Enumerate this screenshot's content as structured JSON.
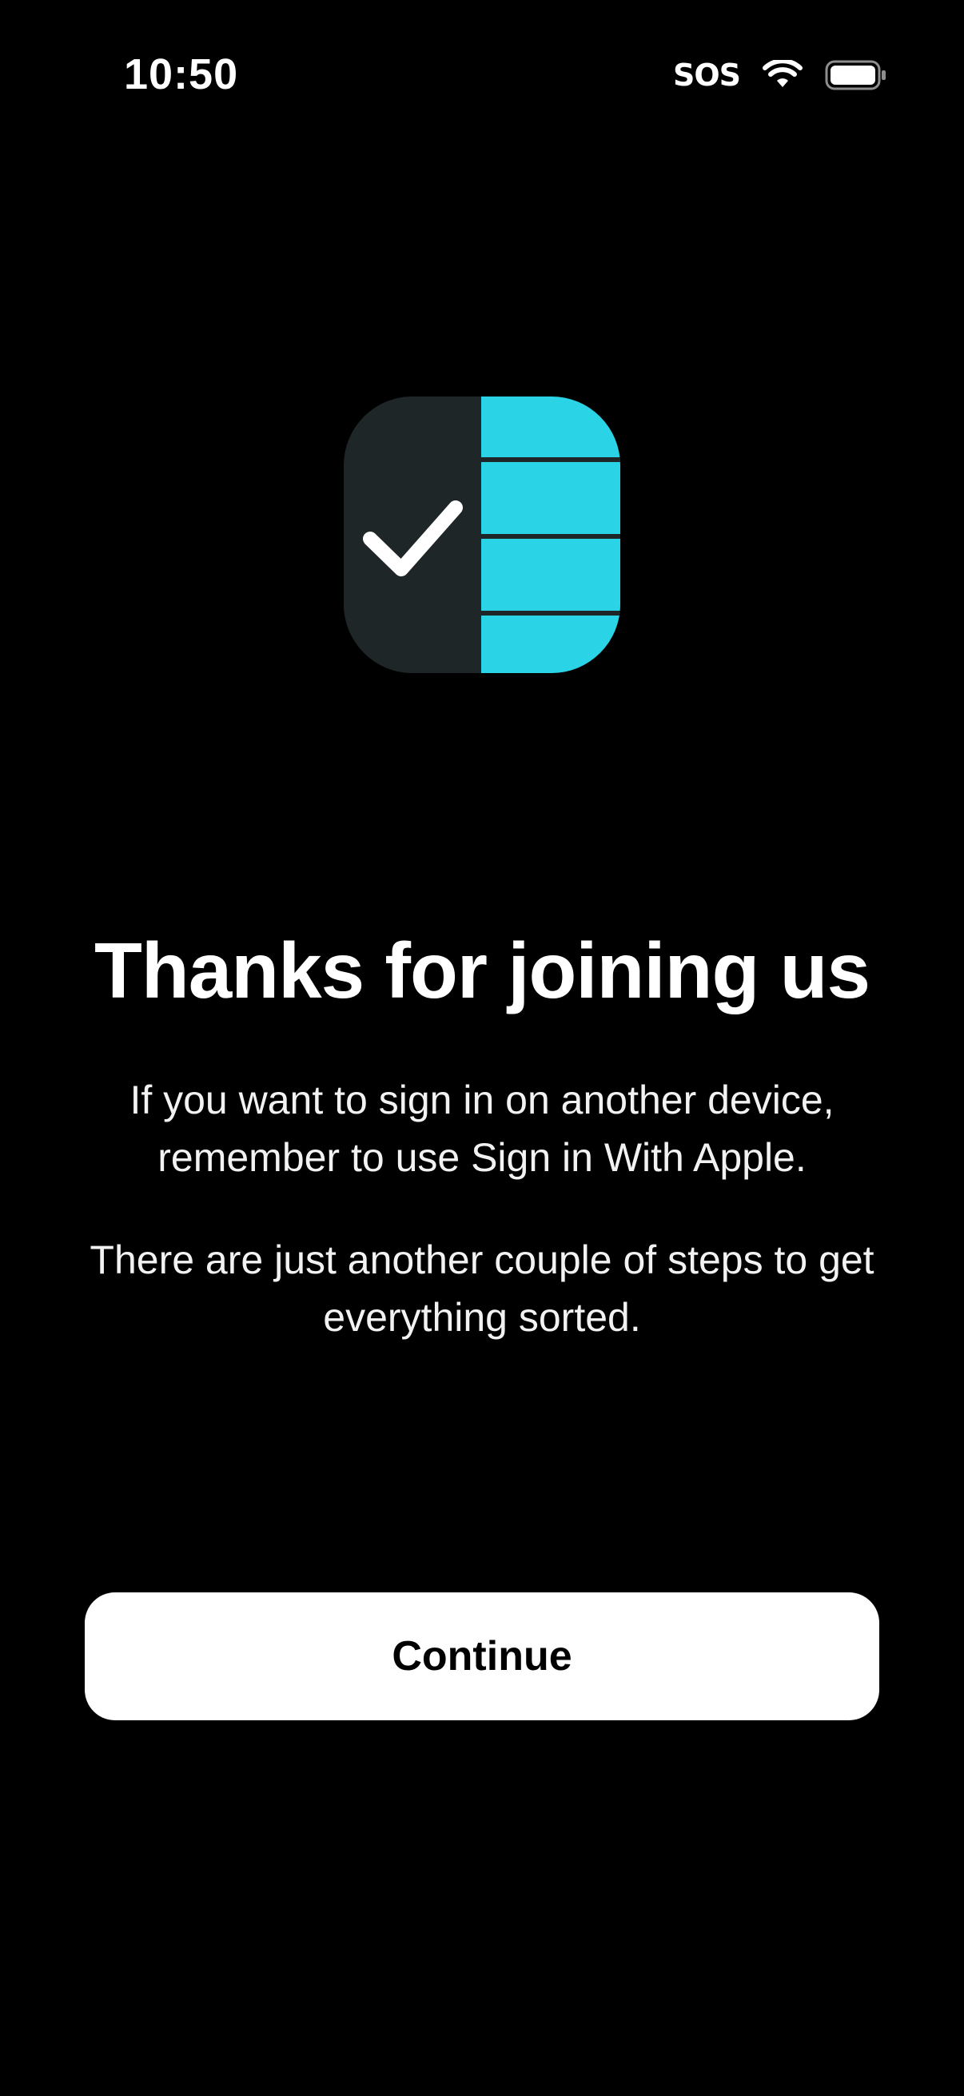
{
  "status_bar": {
    "time": "10:50",
    "sos": "SOS",
    "icons": [
      "wifi-icon",
      "battery-icon"
    ]
  },
  "app_icon": {
    "name": "checklist-app-icon",
    "colors": {
      "dark": "#1f2628",
      "accent": "#2ad3e6",
      "check": "#ffffff"
    }
  },
  "main": {
    "title": "Thanks for joining us",
    "paragraph1": "If you want to sign in on another device, remember to use Sign in With Apple.",
    "paragraph2": "There are just another couple of steps to get everything sorted."
  },
  "actions": {
    "continue_label": "Continue"
  },
  "colors": {
    "background": "#000000",
    "button_bg": "#ffffff",
    "button_text": "#000000"
  }
}
